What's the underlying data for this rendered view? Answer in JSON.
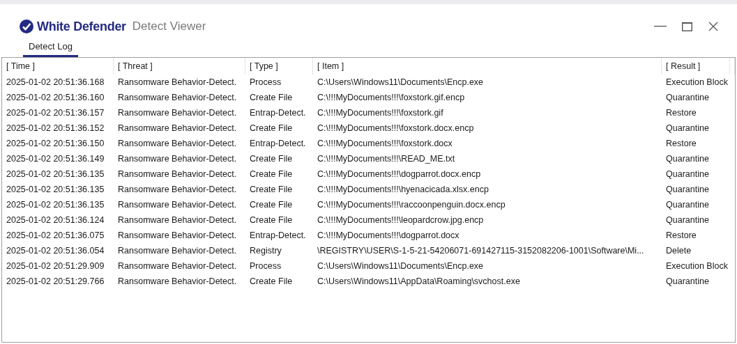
{
  "window": {
    "brand": "White Defender",
    "title": "Detect Viewer"
  },
  "tabs": [
    {
      "label": "Detect Log",
      "selected": true
    }
  ],
  "table": {
    "columns": [
      "[ Time ]",
      "[ Threat ]",
      "[ Type ]",
      "[ Item ]",
      "[ Result ]"
    ],
    "rows": [
      [
        "2025-01-02 20:51:36.168",
        "Ransomware Behavior-Detect.",
        "Process",
        "C:\\Users\\Windows11\\Documents\\Encp.exe",
        "Execution Block"
      ],
      [
        "2025-01-02 20:51:36.160",
        "Ransomware Behavior-Detect.",
        "Create File",
        "C:\\!!!MyDocuments!!!\\foxstork.gif.encp",
        "Quarantine"
      ],
      [
        "2025-01-02 20:51:36.157",
        "Ransomware Behavior-Detect.",
        "Entrap-Detect.",
        "C:\\!!!MyDocuments!!!\\foxstork.gif",
        "Restore"
      ],
      [
        "2025-01-02 20:51:36.152",
        "Ransomware Behavior-Detect.",
        "Create File",
        "C:\\!!!MyDocuments!!!\\foxstork.docx.encp",
        "Quarantine"
      ],
      [
        "2025-01-02 20:51:36.150",
        "Ransomware Behavior-Detect.",
        "Entrap-Detect.",
        "C:\\!!!MyDocuments!!!\\foxstork.docx",
        "Restore"
      ],
      [
        "2025-01-02 20:51:36.149",
        "Ransomware Behavior-Detect.",
        "Create File",
        "C:\\!!!MyDocuments!!!\\READ_ME.txt",
        "Quarantine"
      ],
      [
        "2025-01-02 20:51:36.135",
        "Ransomware Behavior-Detect.",
        "Create File",
        "C:\\!!!MyDocuments!!!\\dogparrot.docx.encp",
        "Quarantine"
      ],
      [
        "2025-01-02 20:51:36.135",
        "Ransomware Behavior-Detect.",
        "Create File",
        "C:\\!!!MyDocuments!!!\\hyenacicada.xlsx.encp",
        "Quarantine"
      ],
      [
        "2025-01-02 20:51:36.135",
        "Ransomware Behavior-Detect.",
        "Create File",
        "C:\\!!!MyDocuments!!!\\raccoonpenguin.docx.encp",
        "Quarantine"
      ],
      [
        "2025-01-02 20:51:36.124",
        "Ransomware Behavior-Detect.",
        "Create File",
        "C:\\!!!MyDocuments!!!\\leopardcrow.jpg.encp",
        "Quarantine"
      ],
      [
        "2025-01-02 20:51:36.075",
        "Ransomware Behavior-Detect.",
        "Entrap-Detect.",
        "C:\\!!!MyDocuments!!!\\dogparrot.docx",
        "Restore"
      ],
      [
        "2025-01-02 20:51:36.054",
        "Ransomware Behavior-Detect.",
        "Registry",
        "\\REGISTRY\\USER\\S-1-5-21-54206071-691427115-3152082206-1001\\Software\\Mi...",
        "Delete"
      ],
      [
        "2025-01-02 20:51:29.909",
        "Ransomware Behavior-Detect.",
        "Process",
        "C:\\Users\\Windows11\\Documents\\Encp.exe",
        "Execution Block"
      ],
      [
        "2025-01-02 20:51:29.766",
        "Ransomware Behavior-Detect.",
        "Create File",
        "C:\\Users\\Windows11\\AppData\\Roaming\\svchost.exe",
        "Quarantine"
      ]
    ]
  }
}
